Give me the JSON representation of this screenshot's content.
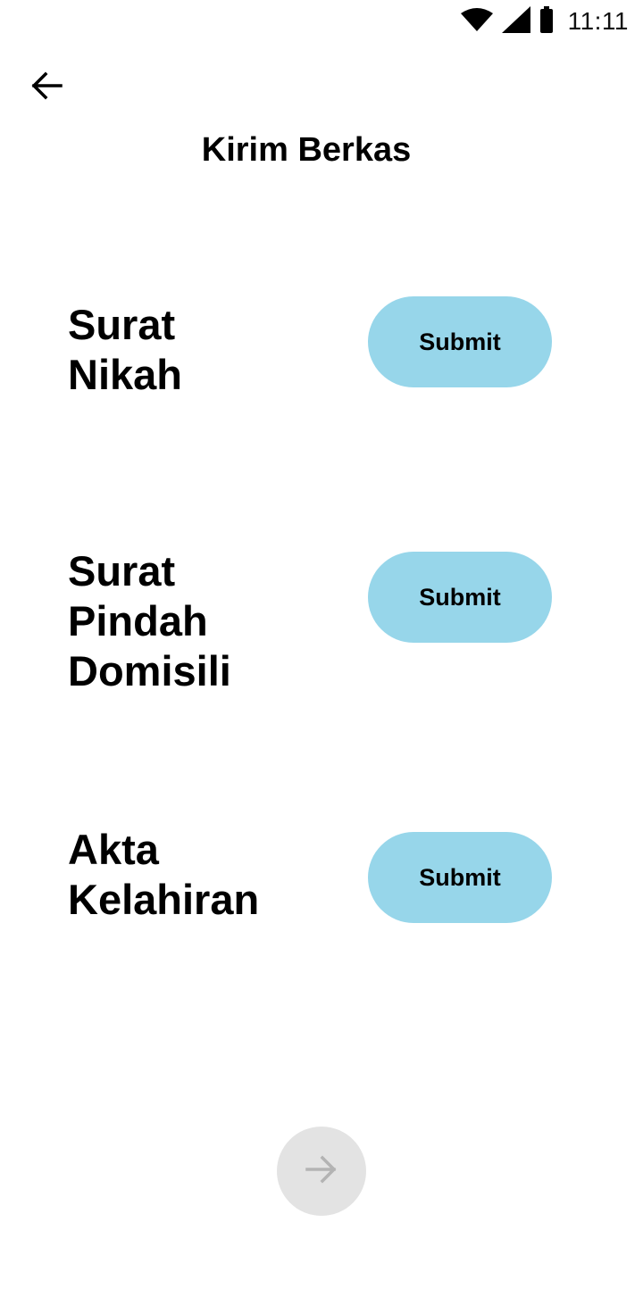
{
  "status_bar": {
    "time": "11:11",
    "icons": [
      "wifi-icon",
      "signal-icon",
      "battery-icon"
    ]
  },
  "header": {
    "back_icon": "arrow-left-icon",
    "title": "Kirim Berkas"
  },
  "documents": [
    {
      "label_lines": [
        "Surat",
        "Nikah"
      ],
      "button_label": "Submit"
    },
    {
      "label_lines": [
        "Surat",
        "Pindah",
        "Domisili"
      ],
      "button_label": "Submit"
    },
    {
      "label_lines": [
        "Akta",
        "Kelahiran"
      ],
      "button_label": "Submit"
    }
  ],
  "footer": {
    "next_icon": "arrow-right-icon",
    "next_state": "disabled"
  },
  "colors": {
    "submit_button_bg": "#97d6ea",
    "next_button_bg": "#e3e3e3",
    "next_icon_color": "#b3b3b3",
    "text": "#000000"
  }
}
